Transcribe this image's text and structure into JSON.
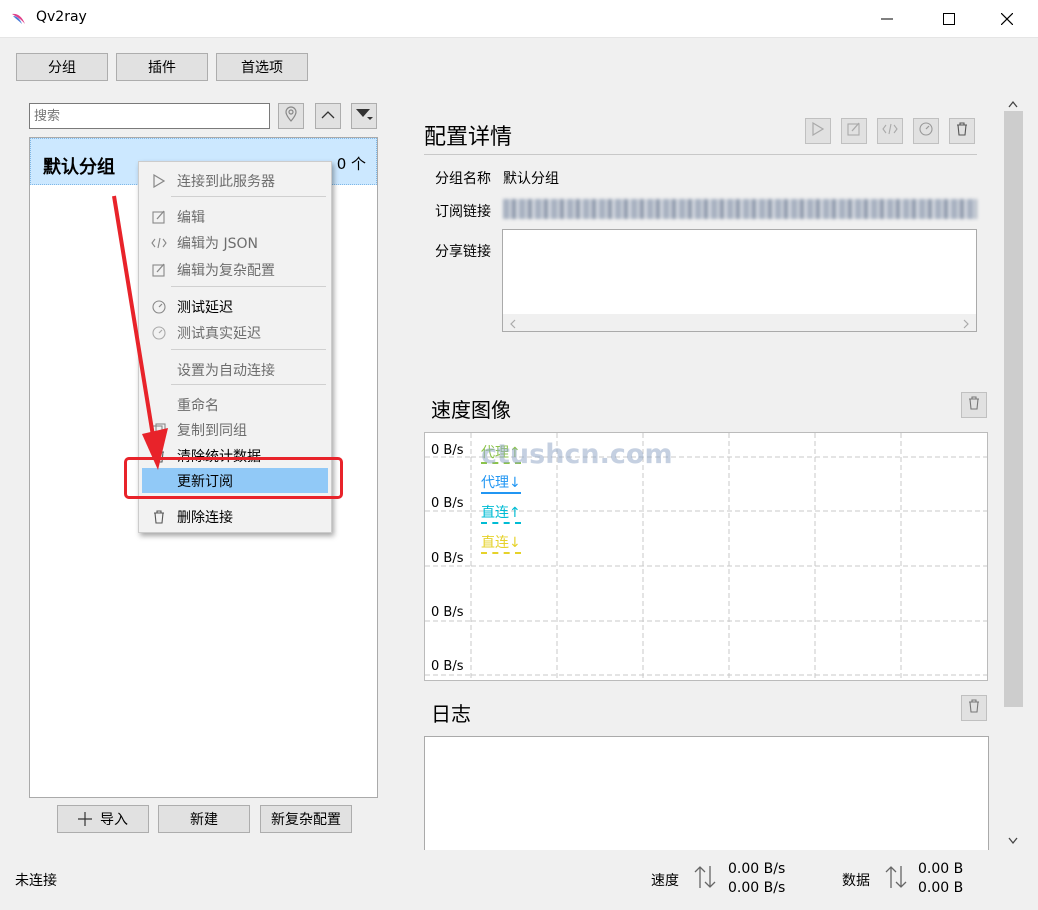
{
  "window": {
    "title": "Qv2ray",
    "accent": "#cce8ff",
    "highlight": "#91c9f7",
    "annotation_color": "#e8232a"
  },
  "toolbar": {
    "group_label": "分组",
    "plugin_label": "插件",
    "prefs_label": "首选项"
  },
  "sidebar": {
    "search_placeholder": "搜索",
    "group": {
      "name": "默认分组",
      "count": "0 个"
    },
    "import_label": "导入",
    "new_label": "新建",
    "new_complex_label": "新复杂配置"
  },
  "context_menu": {
    "items": [
      {
        "label": "连接到此服务器",
        "icon": "play-icon",
        "disabled": true
      },
      {
        "label": "编辑",
        "icon": "edit-icon",
        "disabled": true
      },
      {
        "label": "编辑为 JSON",
        "icon": "code-icon",
        "disabled": true
      },
      {
        "label": "编辑为复杂配置",
        "icon": "edit-icon",
        "disabled": true
      },
      {
        "label": "测试延迟",
        "icon": "gauge-icon",
        "disabled": false
      },
      {
        "label": "测试真实延迟",
        "icon": "gauge-icon",
        "disabled": true
      },
      {
        "label": "设置为自动连接",
        "icon": "",
        "disabled": true
      },
      {
        "label": "重命名",
        "icon": "",
        "disabled": true
      },
      {
        "label": "复制到同组",
        "icon": "copy-icon",
        "disabled": true
      },
      {
        "label": "清除统计数据",
        "icon": "trash-icon",
        "disabled": false
      },
      {
        "label": "更新订阅",
        "icon": "",
        "disabled": false,
        "selected": true
      },
      {
        "label": "删除连接",
        "icon": "trash-icon",
        "disabled": false
      }
    ]
  },
  "details": {
    "title": "配置详情",
    "group_name_label": "分组名称",
    "group_name_value": "默认分组",
    "sub_link_label": "订阅链接",
    "share_link_label": "分享链接"
  },
  "speed": {
    "title": "速度图像",
    "watermark": "ctushcn.com",
    "legend": [
      {
        "label": "代理↑",
        "color": "#8bc34a"
      },
      {
        "label": "代理↓",
        "color": "#2196f3"
      },
      {
        "label": "直连↑",
        "color": "#00bcd4"
      },
      {
        "label": "直连↓",
        "color": "#e6d22a"
      }
    ],
    "y_ticks": [
      "0 B/s",
      "0 B/s",
      "0 B/s",
      "0 B/s",
      "0 B/s"
    ]
  },
  "log": {
    "title": "日志"
  },
  "statusbar": {
    "connection": "未连接",
    "speed_label": "速度",
    "speed_up": "0.00 B/s",
    "speed_down": "0.00 B/s",
    "data_label": "数据",
    "data_up": "0.00 B",
    "data_down": "0.00 B"
  }
}
